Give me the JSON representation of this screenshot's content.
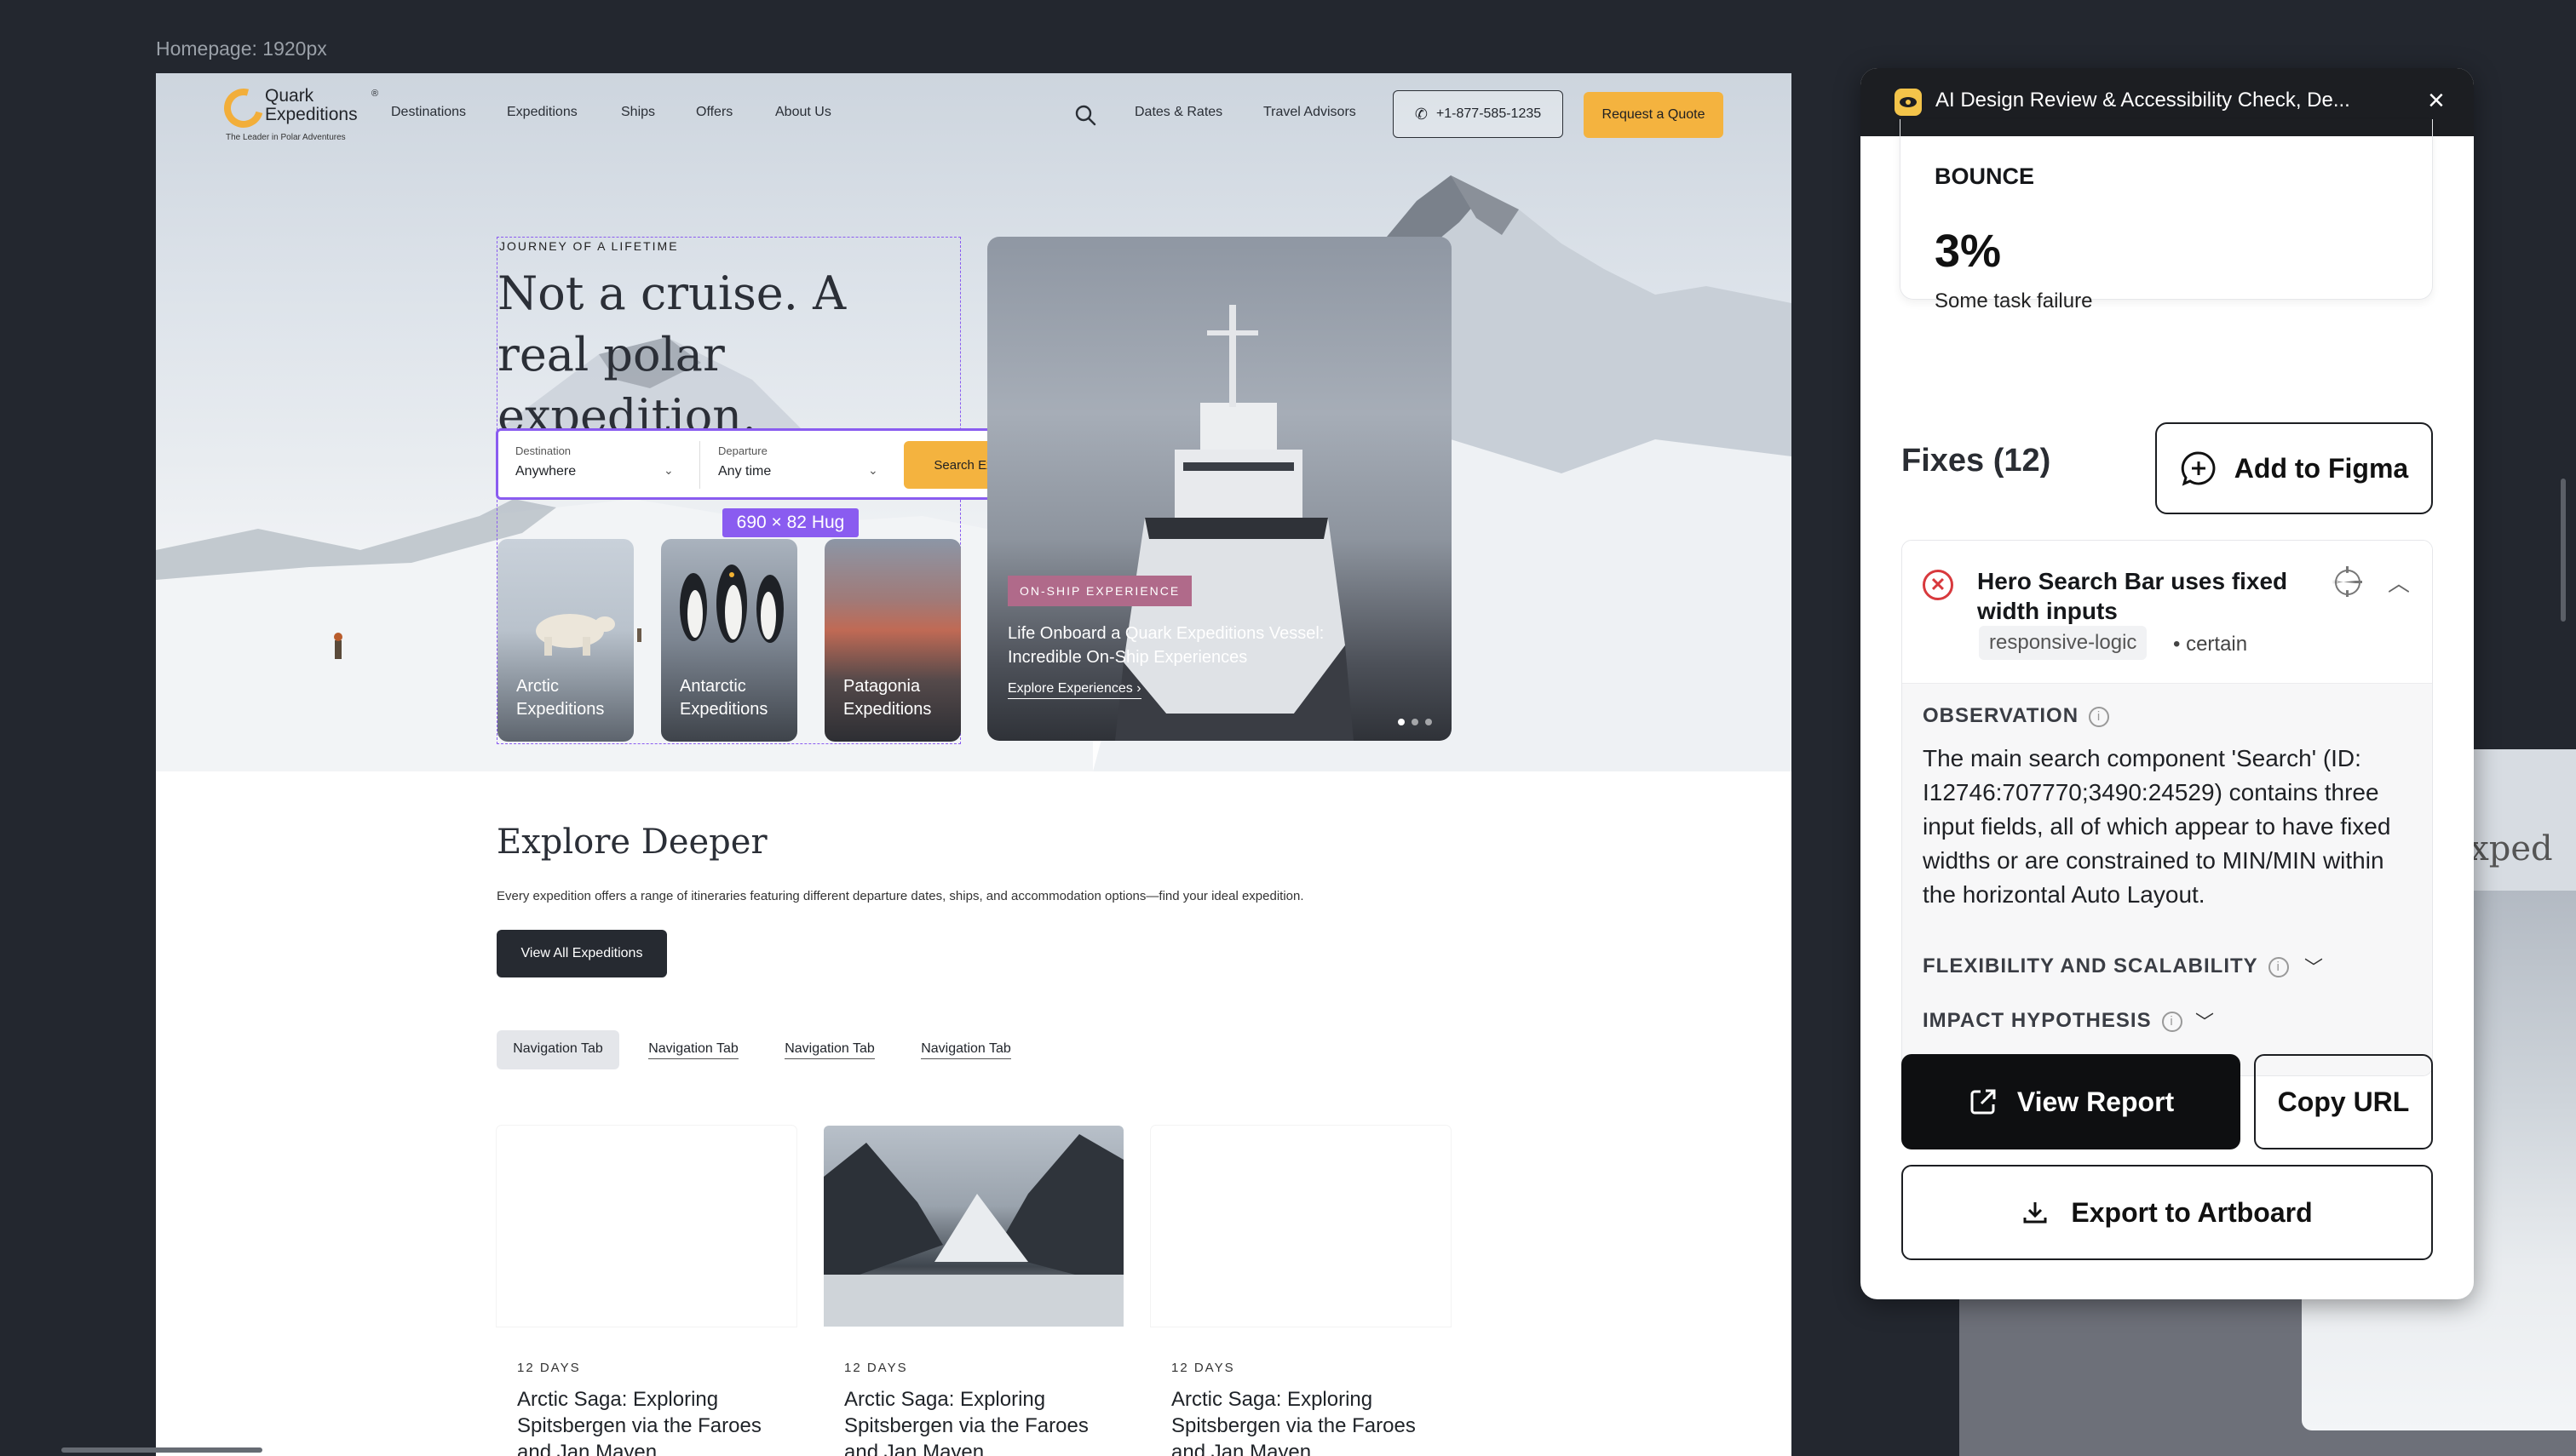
{
  "frame": {
    "label": "Homepage: 1920px"
  },
  "site": {
    "logo": {
      "name": "Quark Expeditions",
      "registered": "®",
      "tagline": "The Leader in Polar Adventures"
    },
    "nav": [
      "Destinations",
      "Expeditions",
      "Ships",
      "Offers",
      "About Us"
    ],
    "utility_links": [
      "Dates & Rates",
      "Travel Advisors"
    ],
    "phone": "+1-877-585-1235",
    "quote_label": "Request a Quote",
    "hero": {
      "eyebrow": "JOURNEY OF A LIFETIME",
      "title": "Not a cruise. A real polar expedition.",
      "search": {
        "destination_label": "Destination",
        "destination_value": "Anywhere",
        "departure_label": "Departure",
        "departure_value": "Any time",
        "button_label": "Search Expeditions"
      },
      "dimension_badge": "690 × 82 Hug",
      "destinations": [
        {
          "label": "Arctic Expeditions"
        },
        {
          "label": "Antarctic Expeditions"
        },
        {
          "label": "Patagonia Expeditions"
        }
      ],
      "feature": {
        "badge": "ON-SHIP EXPERIENCE",
        "title": "Life Onboard a Quark Expeditions Vessel: Incredible On-Ship Experiences",
        "link": "Explore Experiences",
        "slides": 3,
        "active_slide": 1
      }
    },
    "explore": {
      "title": "Explore Deeper",
      "description": "Every expedition offers a range of itineraries featuring different departure dates, ships, and accommodation options—find your ideal expedition.",
      "button": "View All Expeditions",
      "tabs": [
        "Navigation Tab",
        "Navigation Tab",
        "Navigation Tab",
        "Navigation Tab"
      ],
      "active_tab": 0,
      "trips": [
        {
          "days": "12 DAYS",
          "title": "Arctic Saga: Exploring Spitsbergen via the Faroes and Jan Mayen"
        },
        {
          "days": "12 DAYS",
          "title": "Arctic Saga: Exploring Spitsbergen via the Faroes and Jan Mayen"
        },
        {
          "days": "12 DAYS",
          "title": "Arctic Saga: Exploring Spitsbergen via the Faroes and Jan Mayen"
        }
      ]
    }
  },
  "right_frame": {
    "partial_text": "f Exped"
  },
  "panel": {
    "title": "AI Design Review & Accessibility Check, De...",
    "metric": {
      "label": "BOUNCE",
      "value": "3%",
      "sub": "Some task failure"
    },
    "fixes_title": "Fixes (12)",
    "add_figma": "Add to Figma",
    "issue": {
      "title": "Hero Search Bar uses fixed width inputs",
      "tag": "responsive-logic",
      "separator": "•",
      "certainty": "certain",
      "observation_label": "OBSERVATION",
      "observation_text": "The main search component 'Search' (ID: I12746:707770;3490:24529) contains three input fields, all of which appear to have fixed widths or are constrained to MIN/MIN within the horizontal Auto Layout.",
      "flex_label": "FLEXIBILITY AND SCALABILITY",
      "impact_label": "IMPACT HYPOTHESIS"
    },
    "view_report": "View Report",
    "copy_url": "Copy URL",
    "export": "Export to Artboard"
  },
  "colors": {
    "accent": "#f4b33f",
    "selection": "#8a5cf0",
    "badge": "#b06a8a",
    "error": "#d8393d",
    "panel_header": "#1c1e22"
  }
}
